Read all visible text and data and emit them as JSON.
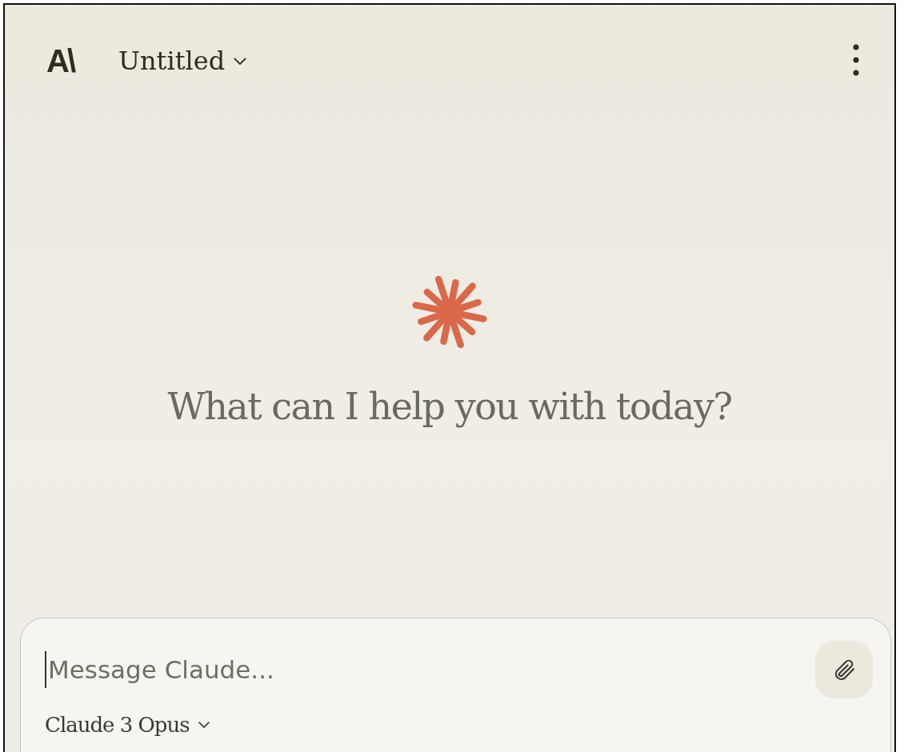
{
  "header": {
    "logo": "A\\",
    "title": "Untitled"
  },
  "greeting": "What can I help you with today?",
  "composer": {
    "placeholder": "Message Claude...",
    "model": "Claude 3 Opus"
  }
}
